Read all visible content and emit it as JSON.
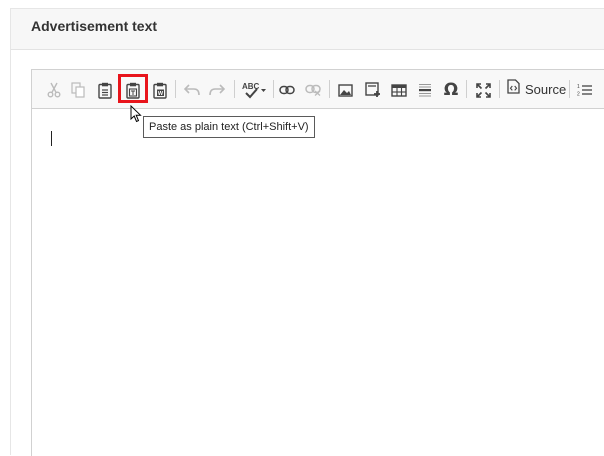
{
  "panel": {
    "title": "Advertisement text"
  },
  "toolbar": {
    "buttons": [
      {
        "name": "cut-icon"
      },
      {
        "name": "copy-icon"
      },
      {
        "name": "paste-icon"
      },
      {
        "name": "paste-plain-text-icon"
      },
      {
        "name": "paste-from-word-icon"
      },
      {
        "name": "undo-icon"
      },
      {
        "name": "redo-icon"
      },
      {
        "name": "spellcheck-icon"
      },
      {
        "name": "link-icon"
      },
      {
        "name": "unlink-icon"
      },
      {
        "name": "image-icon"
      },
      {
        "name": "insert-media-icon"
      },
      {
        "name": "table-icon"
      },
      {
        "name": "horizontal-line-icon"
      },
      {
        "name": "special-character-icon"
      },
      {
        "name": "maximize-icon"
      },
      {
        "name": "source-icon"
      },
      {
        "name": "numbered-list-icon"
      }
    ],
    "source_label": "Source",
    "omega_glyph": "Ω"
  },
  "tooltip": {
    "text": "Paste as plain text (Ctrl+Shift+V)"
  },
  "colors": {
    "highlight": "#e8141b",
    "icon": "#444444",
    "icon_disabled": "#bbbbbb"
  }
}
